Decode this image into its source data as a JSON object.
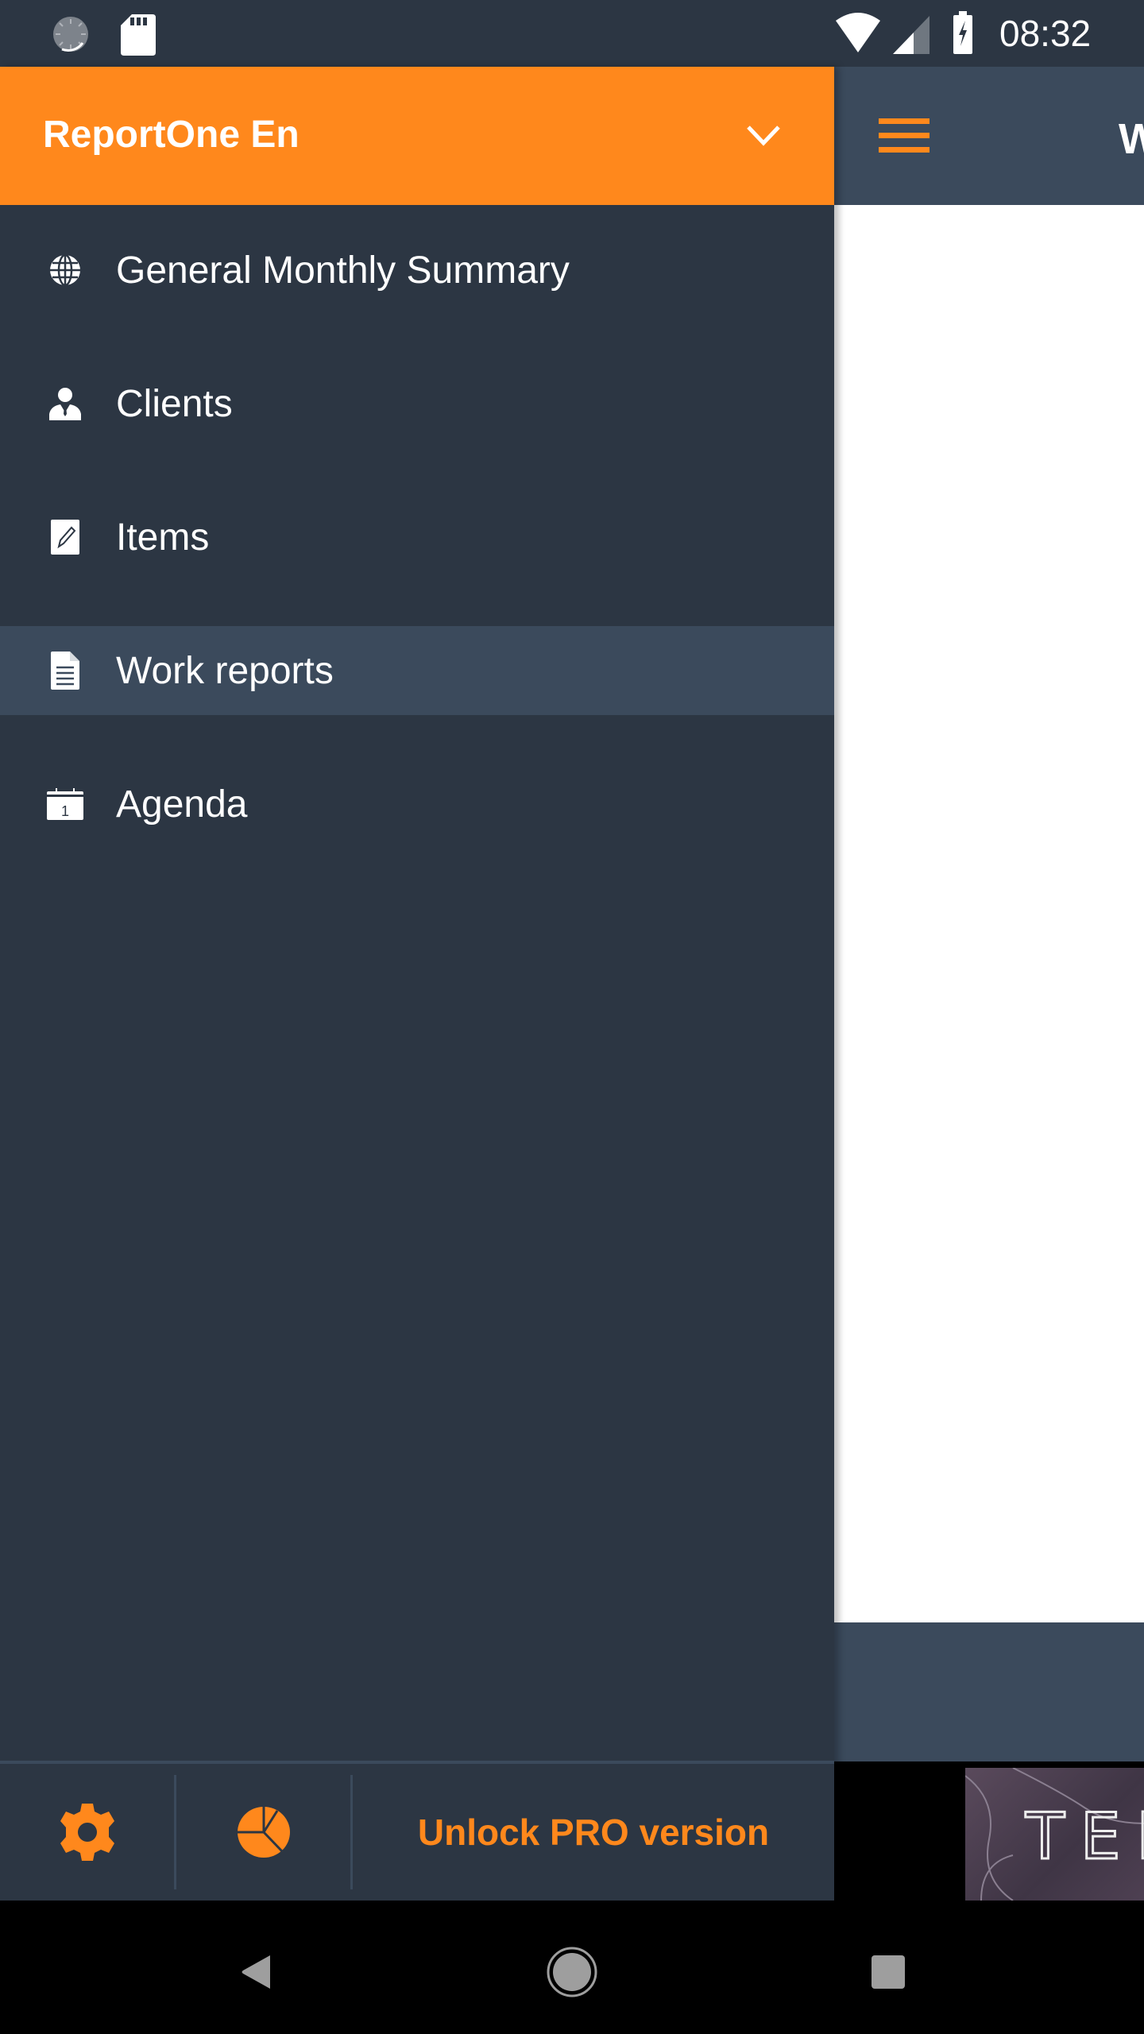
{
  "status_bar": {
    "time": "08:32",
    "left_icons": [
      "sync-icon",
      "sd-card-icon"
    ],
    "right_icons": [
      "wifi-icon",
      "cell-signal-icon",
      "battery-charging-icon"
    ]
  },
  "drawer": {
    "account_name": "ReportOne En",
    "account_switch_icon": "chevron-down-icon",
    "menu_items": [
      {
        "label": "General Monthly Summary",
        "icon": "globe-icon",
        "selected": false
      },
      {
        "label": "Clients",
        "icon": "person-icon",
        "selected": false
      },
      {
        "label": "Items",
        "icon": "edit-document-icon",
        "selected": false
      },
      {
        "label": "Work reports",
        "icon": "document-icon",
        "selected": true
      },
      {
        "label": "Agenda",
        "icon": "calendar-icon",
        "selected": false
      }
    ],
    "calendar_day": "1",
    "footer": {
      "settings_icon": "gear-icon",
      "stats_icon": "pie-chart-icon",
      "unlock_label": "Unlock PRO version"
    }
  },
  "background_app": {
    "toolbar_title_partial": "W",
    "menu_icon": "hamburger-icon",
    "ad_text_partial": "TER"
  },
  "nav_bar": {
    "buttons": [
      "back-icon",
      "home-icon",
      "recents-icon"
    ]
  },
  "colors": {
    "accent": "#ff881c",
    "drawer_bg": "#2c3643",
    "selected_bg": "#3b4a5c",
    "toolbar_bg": "#3b4a5c"
  }
}
